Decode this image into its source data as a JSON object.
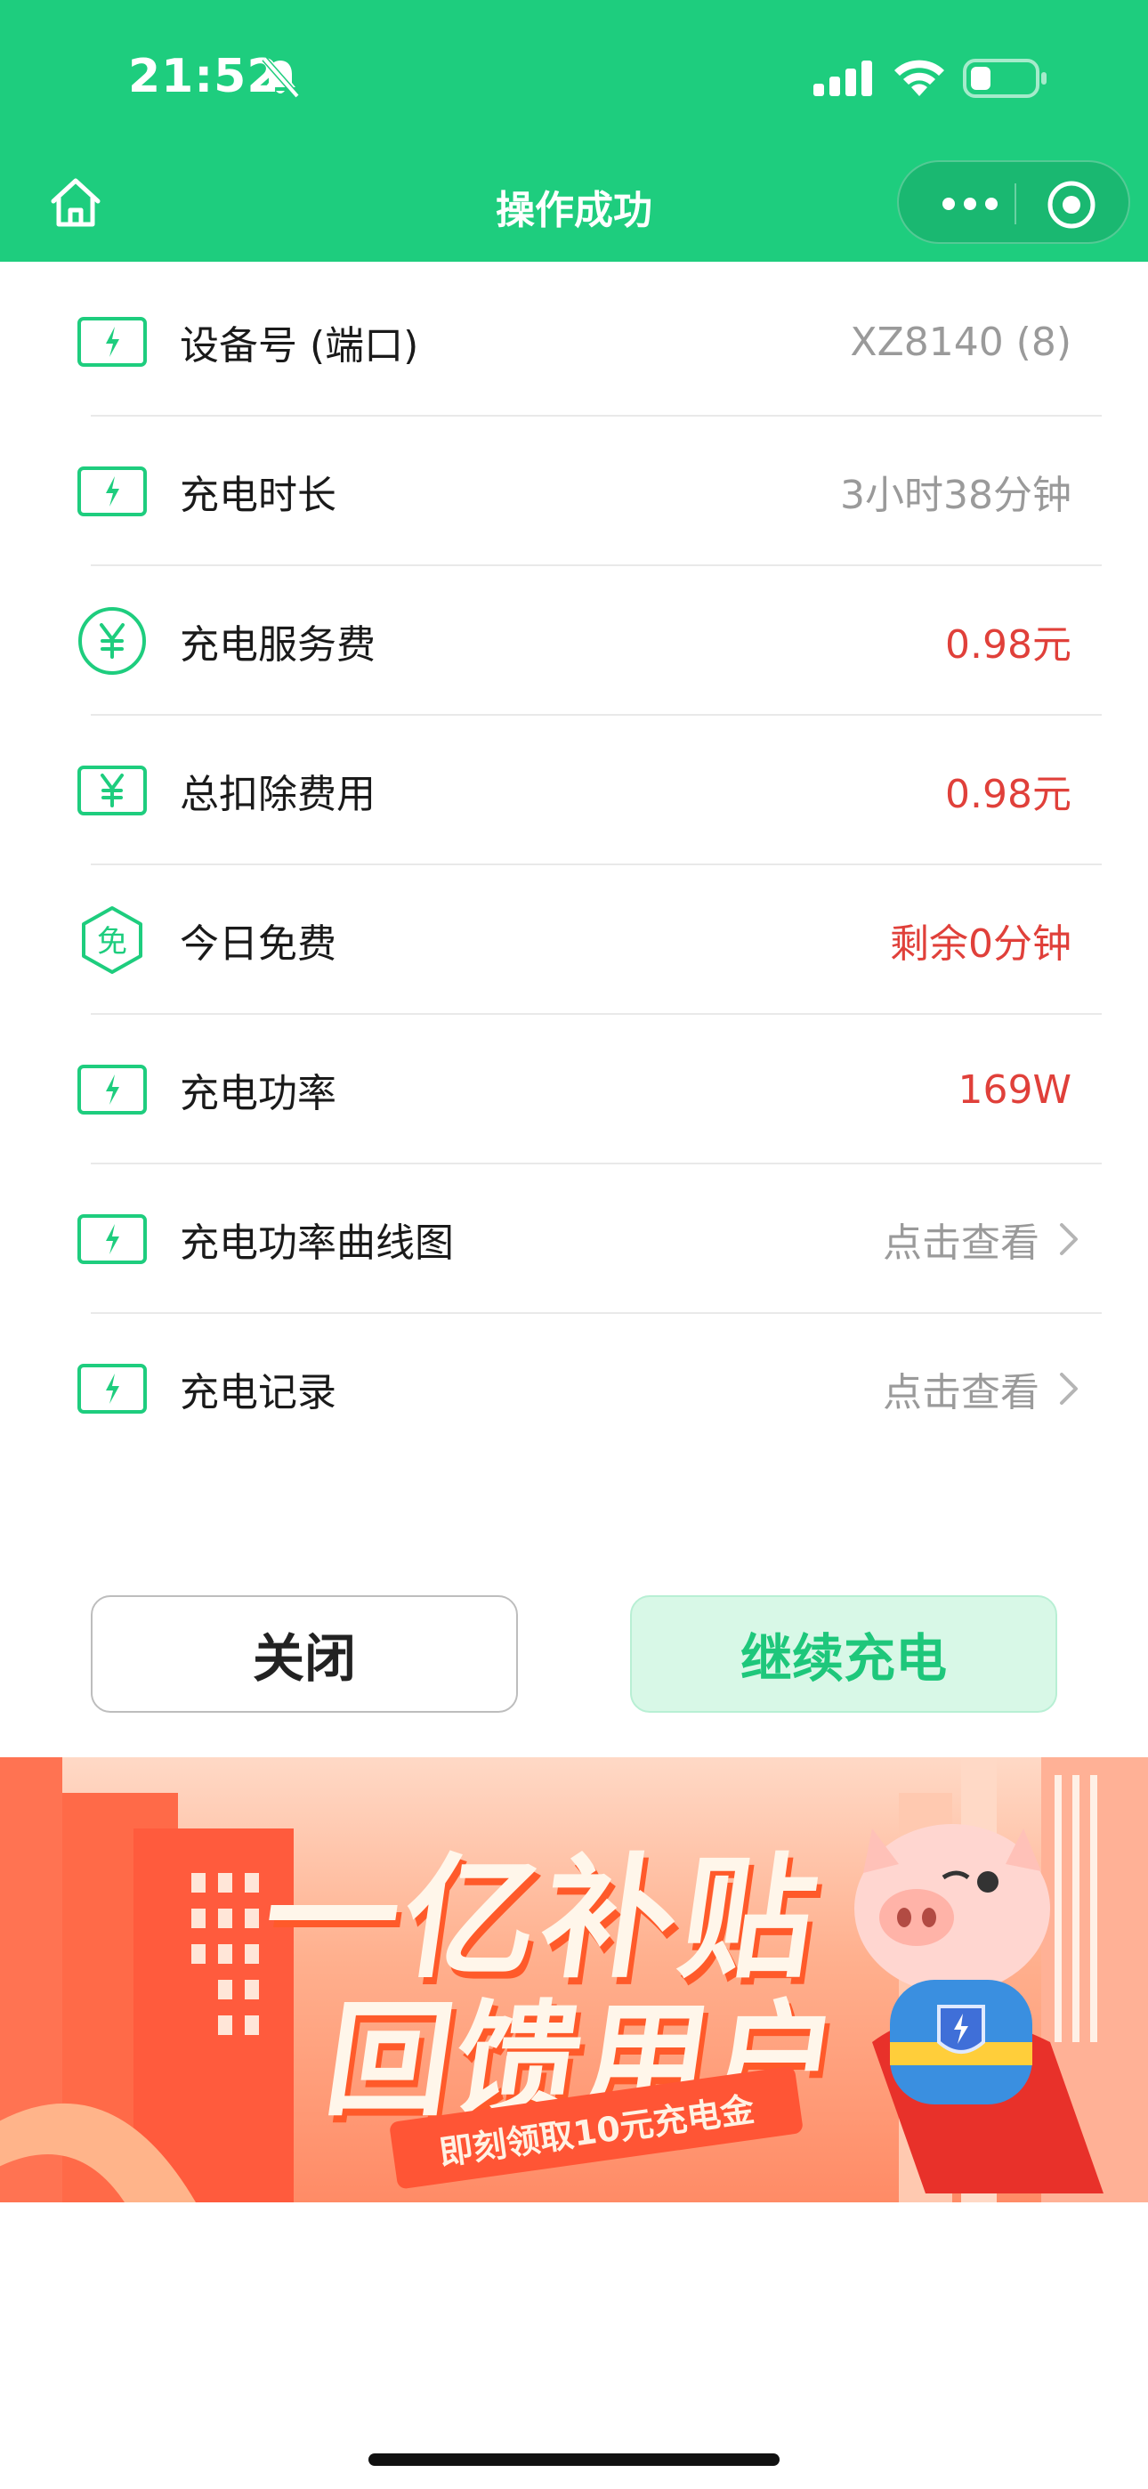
{
  "status_bar": {
    "time": "21:52"
  },
  "nav": {
    "title": "操作成功"
  },
  "rows": [
    {
      "label": "设备号 (端口)",
      "value": "XZ8140 (8)",
      "icon": "bolt-box-icon"
    },
    {
      "label": "充电时长",
      "value": "3小时38分钟",
      "icon": "bolt-box-icon"
    },
    {
      "label": "充电服务费",
      "value": "0.98元",
      "icon": "yen-circle-icon"
    },
    {
      "label": "总扣除费用",
      "value": "0.98元",
      "icon": "yen-box-icon"
    },
    {
      "label": "今日免费",
      "value": "剩余0分钟",
      "icon": "free-hexagon-icon",
      "icon_text": "免"
    },
    {
      "label": "充电功率",
      "value": "169W",
      "icon": "bolt-box-icon"
    },
    {
      "label": "充电功率曲线图",
      "value": "点击查看",
      "icon": "bolt-box-icon"
    },
    {
      "label": "充电记录",
      "value": "点击查看",
      "icon": "bolt-box-icon"
    }
  ],
  "buttons": {
    "close": "关闭",
    "continue": "继续充电"
  },
  "banner": {
    "title_line1": "一亿补贴",
    "title_line2": "回馈用户",
    "ribbon": "即刻领取10元充电金"
  },
  "colors": {
    "brand_green": "#1ecd7e",
    "value_red": "#e0403a",
    "value_gray": "#9a9a9a",
    "continue_bg": "#d8f8e7"
  }
}
